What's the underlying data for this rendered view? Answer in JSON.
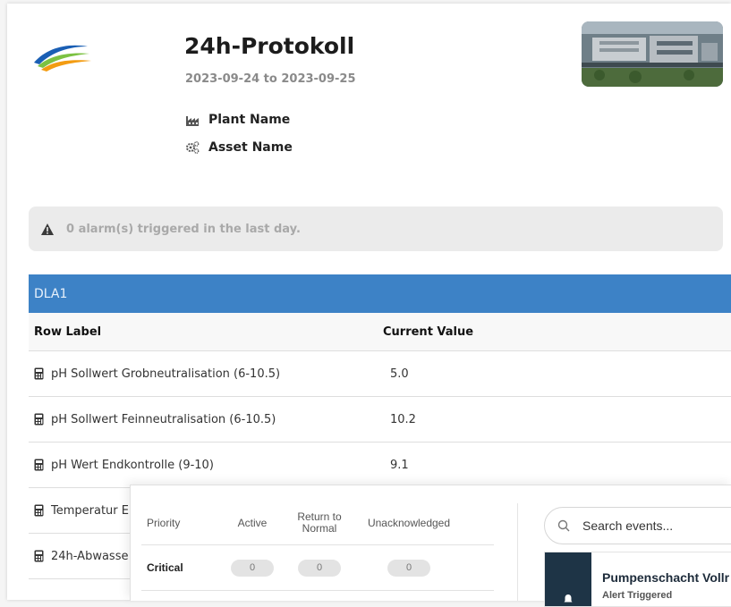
{
  "report": {
    "title": "24h-Protokoll",
    "date_range": "2023-09-24 to 2023-09-25",
    "plant_label": "Plant Name",
    "asset_label": "Asset Name"
  },
  "alarm_banner": {
    "text": "0 alarm(s) triggered in the last day."
  },
  "table": {
    "section_title": "DLA1",
    "headers": {
      "row_label": "Row Label",
      "current_value": "Current Value"
    },
    "rows": [
      {
        "label": "pH Sollwert Grobneutralisation (6-10.5)",
        "value": "5.0"
      },
      {
        "label": "pH Sollwert Feinneutralisation (6-10.5)",
        "value": "10.2"
      },
      {
        "label": "pH Wert Endkontrolle (9-10)",
        "value": "9.1"
      },
      {
        "label": "Temperatur E",
        "value": ""
      },
      {
        "label": "24h-Abwasse",
        "value": ""
      }
    ]
  },
  "priority_table": {
    "headers": {
      "priority": "Priority",
      "active": "Active",
      "return_to_normal": "Return to Normal",
      "unacknowledged": "Unacknowledged"
    },
    "rows": [
      {
        "priority": "Critical",
        "active": "0",
        "return_to_normal": "0",
        "unacknowledged": "0"
      }
    ]
  },
  "events": {
    "search_placeholder": "Search events...",
    "items": [
      {
        "title": "Pumpenschacht Vollr",
        "status": "Alert Triggered"
      }
    ]
  },
  "colors": {
    "header_blue": "#3d82c6",
    "event_accent": "#1e3446",
    "alarm_bg": "#ebebeb"
  },
  "icons": {
    "logo": "company-wave-logo",
    "plant": "factory-icon",
    "asset": "gears-icon",
    "alarm": "warning-icon",
    "row": "calculator-icon",
    "search": "search-icon"
  }
}
